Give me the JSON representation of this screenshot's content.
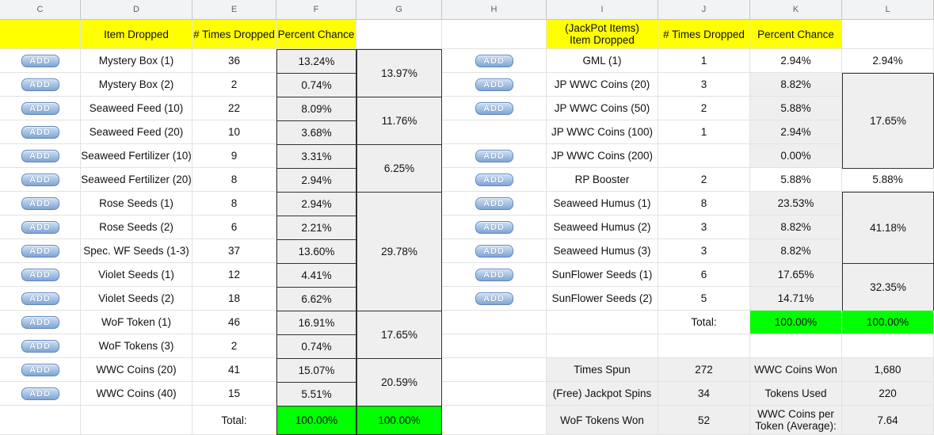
{
  "columns": [
    "C",
    "D",
    "E",
    "F",
    "G",
    "H",
    "I",
    "J",
    "K",
    "L"
  ],
  "button_label": "ADD",
  "left_table": {
    "headers": {
      "item": "Item Dropped",
      "times": "# Times Dropped",
      "percent": "Percent Chance"
    },
    "rows": [
      {
        "item": "Mystery Box (1)",
        "times": "36",
        "percent": "13.24%"
      },
      {
        "item": "Mystery Box (2)",
        "times": "2",
        "percent": "0.74%"
      },
      {
        "item": "Seaweed Feed (10)",
        "times": "22",
        "percent": "8.09%"
      },
      {
        "item": "Seaweed Feed (20)",
        "times": "10",
        "percent": "3.68%"
      },
      {
        "item": "Seaweed Fertilizer (10)",
        "times": "9",
        "percent": "3.31%"
      },
      {
        "item": "Seaweed Fertilizer (20)",
        "times": "8",
        "percent": "2.94%"
      },
      {
        "item": "Rose Seeds (1)",
        "times": "8",
        "percent": "2.94%"
      },
      {
        "item": "Rose Seeds (2)",
        "times": "6",
        "percent": "2.21%"
      },
      {
        "item": "Spec. WF Seeds (1-3)",
        "times": "37",
        "percent": "13.60%"
      },
      {
        "item": "Violet Seeds (1)",
        "times": "12",
        "percent": "4.41%"
      },
      {
        "item": "Violet Seeds (2)",
        "times": "18",
        "percent": "6.62%"
      },
      {
        "item": "WoF Token (1)",
        "times": "46",
        "percent": "16.91%"
      },
      {
        "item": "WoF Tokens (3)",
        "times": "2",
        "percent": "0.74%"
      },
      {
        "item": "WWC Coins (20)",
        "times": "41",
        "percent": "15.07%"
      },
      {
        "item": "WWC Coins (40)",
        "times": "15",
        "percent": "5.51%"
      }
    ],
    "groups": [
      "13.97%",
      "11.76%",
      "6.25%",
      "29.78%",
      "17.65%",
      "20.59%"
    ],
    "total_label": "Total:",
    "total_percent": "100.00%",
    "total_group": "100.00%"
  },
  "right_table": {
    "headers": {
      "item": "(JackPot Items)\nItem Dropped",
      "times": "# Times Dropped",
      "percent": "Percent Chance"
    },
    "rows": [
      {
        "item": "GML (1)",
        "times": "1",
        "percent": "2.94%"
      },
      {
        "item": "JP WWC Coins (20)",
        "times": "3",
        "percent": "8.82%"
      },
      {
        "item": "JP WWC Coins (50)",
        "times": "2",
        "percent": "5.88%"
      },
      {
        "item": "JP WWC Coins (100)",
        "times": "1",
        "percent": "2.94%"
      },
      {
        "item": "JP WWC Coins (200)",
        "times": "",
        "percent": "0.00%"
      },
      {
        "item": "RP Booster",
        "times": "2",
        "percent": "5.88%"
      },
      {
        "item": "Seaweed Humus (1)",
        "times": "8",
        "percent": "23.53%"
      },
      {
        "item": "Seaweed Humus (2)",
        "times": "3",
        "percent": "8.82%"
      },
      {
        "item": "Seaweed Humus (3)",
        "times": "3",
        "percent": "8.82%"
      },
      {
        "item": "SunFlower Seeds (1)",
        "times": "6",
        "percent": "17.65%"
      },
      {
        "item": "SunFlower Seeds (2)",
        "times": "5",
        "percent": "14.71%"
      }
    ],
    "groups": [
      "2.94%",
      "17.65%",
      "5.88%",
      "41.18%",
      "32.35%"
    ],
    "total_label": "Total:",
    "total_percent": "100.00%",
    "total_group": "100.00%"
  },
  "stats": {
    "times_spun_label": "Times Spun",
    "times_spun": "272",
    "jackpot_label": "(Free) Jackpot Spins",
    "jackpot": "34",
    "tokens_won_label": "WoF Tokens Won",
    "tokens_won": "52",
    "coins_won_label": "WWC Coins Won",
    "coins_won": "1,680",
    "tokens_used_label": "Tokens Used",
    "tokens_used": "220",
    "coins_per_token_label": "WWC Coins per Token (Average):",
    "coins_per_token": "7.64"
  }
}
